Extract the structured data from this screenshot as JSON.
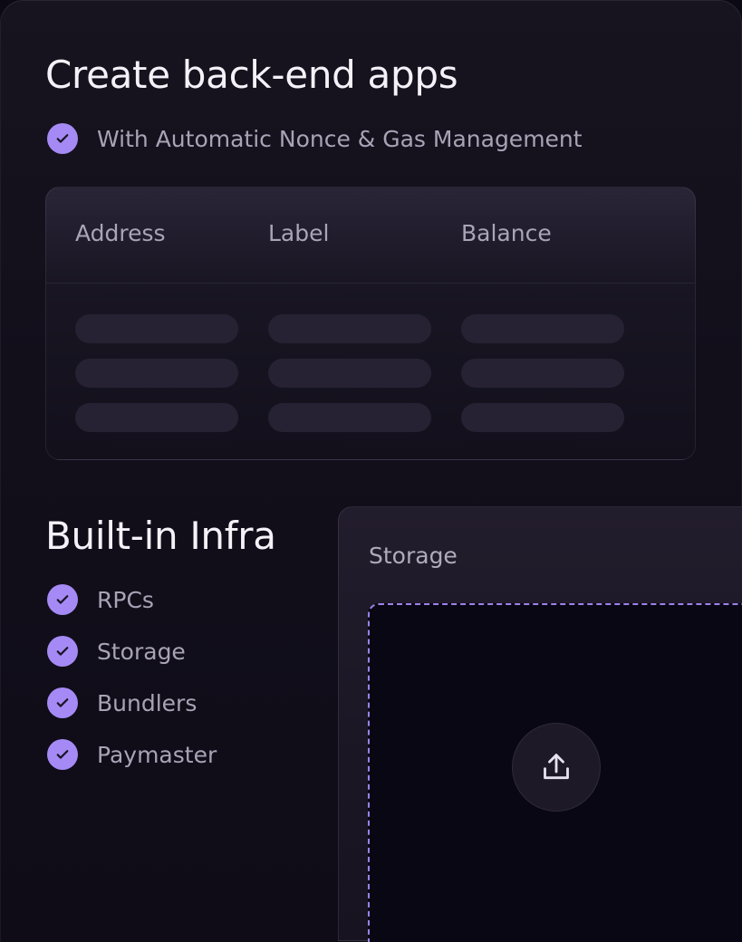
{
  "section_backend": {
    "title": "Create back-end apps",
    "feature": "With Automatic Nonce & Gas Management"
  },
  "wallet_table": {
    "columns": [
      "Address",
      "Label",
      "Balance"
    ],
    "placeholder_rows": 3
  },
  "section_infra": {
    "title": "Built-in Infra",
    "features": [
      "RPCs",
      "Storage",
      "Bundlers",
      "Paymaster"
    ]
  },
  "storage_panel": {
    "title": "Storage",
    "upload_icon": "upload-icon"
  },
  "colors": {
    "background": "#0b0914",
    "accent": "#a58af5",
    "dropzone_border": "#9b82ea",
    "skeleton": "#272233"
  }
}
